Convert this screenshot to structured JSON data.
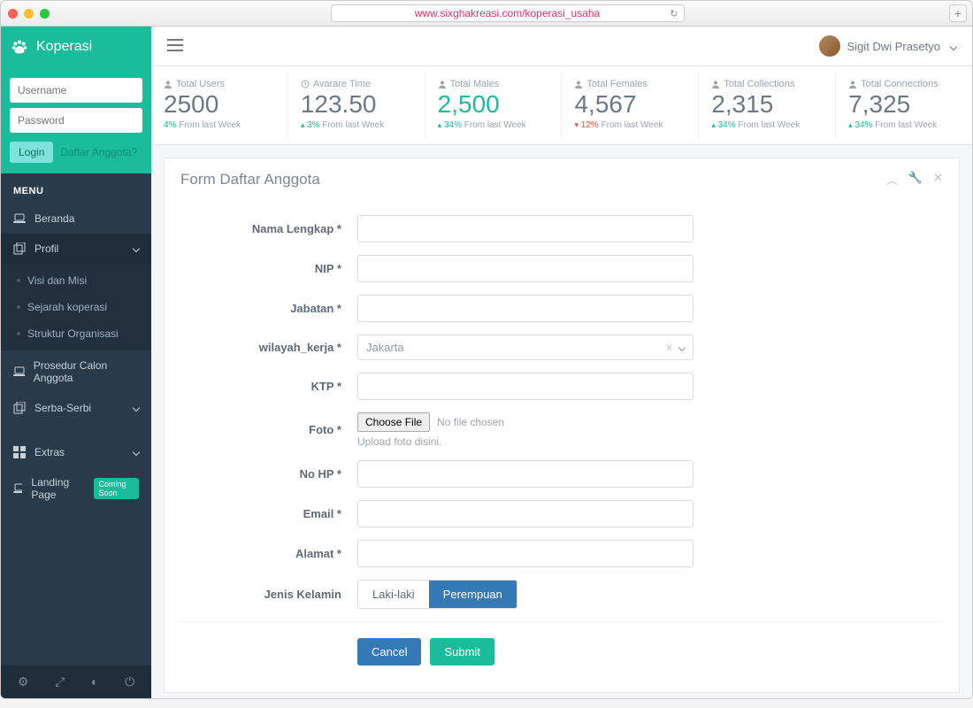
{
  "browser": {
    "url": "www.sixghakreasi.com/koperasi_usaha"
  },
  "brand": "Koperasi",
  "login": {
    "username_placeholder": "Username",
    "password_placeholder": "Password",
    "login_btn": "Login",
    "register_link": "Daftar Anggota?"
  },
  "menu_header": "MENU",
  "nav": {
    "beranda": "Beranda",
    "profil": "Profil",
    "profil_children": [
      "Visi dan Misi",
      "Sejarah koperasi",
      "Struktur Organisasi"
    ],
    "prosedur": "Prosedur Calon Anggota",
    "serba": "Serba-Serbi",
    "extras": "Extras",
    "landing": "Landing Page",
    "coming_soon": "Coming Soon"
  },
  "user": {
    "name": "Sigit Dwi Prasetyo"
  },
  "stats": [
    {
      "icon": "user",
      "label": "Total Users",
      "value": "2500",
      "delta": "4%",
      "dir": "none",
      "foot": "From last Week"
    },
    {
      "icon": "clock",
      "label": "Avarare Time",
      "value": "123.50",
      "delta": "3%",
      "dir": "up",
      "foot": "From last Week"
    },
    {
      "icon": "user",
      "label": "Total Males",
      "value": "2,500",
      "delta": "34%",
      "dir": "up",
      "foot": "From last Week",
      "green": true
    },
    {
      "icon": "user",
      "label": "Total Females",
      "value": "4,567",
      "delta": "12%",
      "dir": "down",
      "foot": "From last Week"
    },
    {
      "icon": "user",
      "label": "Total Collections",
      "value": "2,315",
      "delta": "34%",
      "dir": "up",
      "foot": "From last Week"
    },
    {
      "icon": "user",
      "label": "Total Connections",
      "value": "7,325",
      "delta": "34%",
      "dir": "up",
      "foot": "From last Week"
    }
  ],
  "panel": {
    "title": "Form Daftar Anggota",
    "labels": {
      "nama": "Nama Lengkap *",
      "nip": "NIP *",
      "jabatan": "Jabatan *",
      "wilayah": "wilayah_kerja *",
      "ktp": "KTP *",
      "foto": "Foto *",
      "nohp": "No HP *",
      "email": "Email *",
      "alamat": "Alamat *",
      "jk": "Jenis Kelamin"
    },
    "wilayah_value": "Jakarta",
    "choose_file": "Choose File",
    "no_file": "No file chosen",
    "foto_help": "Upload foto disini.",
    "jk_options": {
      "a": "Laki-laki",
      "b": "Perempuan"
    },
    "cancel": "Cancel",
    "submit": "Submit"
  }
}
